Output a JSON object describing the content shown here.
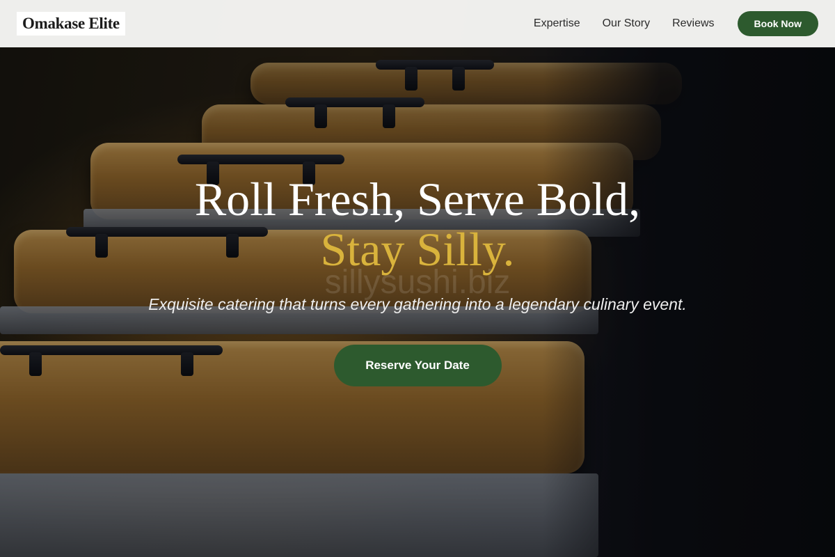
{
  "nav": {
    "logo": "Omakase Elite",
    "links": [
      "Expertise",
      "Our Story",
      "Reviews"
    ],
    "book_label": "Book Now"
  },
  "hero": {
    "headline_line1": "Roll Fresh, Serve Bold,",
    "headline_line2": "Stay Silly.",
    "watermark": "sillysushi.biz",
    "tagline": "Exquisite catering that turns every gathering into a legendary culinary event.",
    "cta_label": "Reserve Your Date"
  },
  "colors": {
    "accent_green": "#2d5a2e",
    "accent_gold": "#d9b33c"
  }
}
